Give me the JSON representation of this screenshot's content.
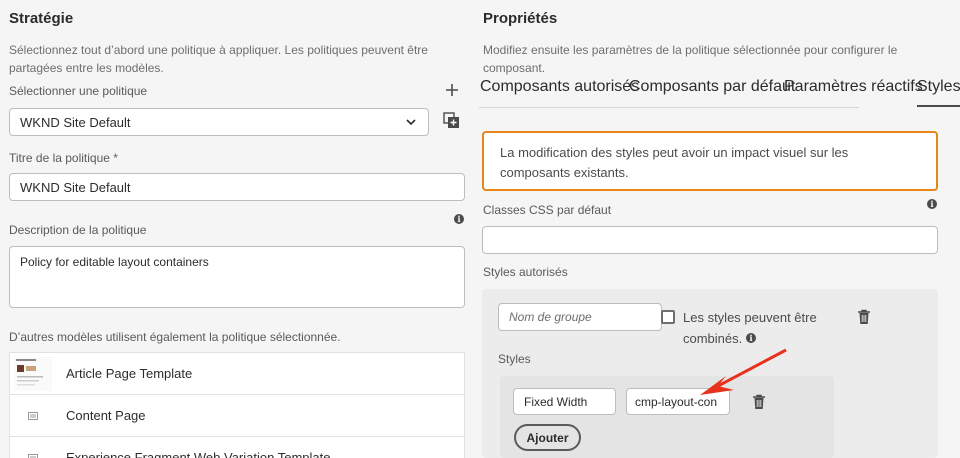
{
  "strategy": {
    "title": "Stratégie",
    "help": "Sélectionnez tout d’abord une politique à appliquer. Les politiques peuvent être partagées entre les modèles.",
    "select_label": "Sélectionner une politique",
    "select_value": "WKND Site Default",
    "title_label": "Titre de la politique *",
    "title_value": "WKND Site Default",
    "description_label": "Description de la politique",
    "description_value": "Policy for editable layout containers",
    "others_label": "D’autres modèles utilisent également la politique sélectionnée.",
    "templates": [
      {
        "name": "Article Page Template"
      },
      {
        "name": "Content Page"
      },
      {
        "name": "Experience Fragment Web Variation Template"
      }
    ]
  },
  "properties": {
    "title": "Propriétés",
    "help": "Modifiez ensuite les paramètres de la politique sélectionnée pour configurer le composant.",
    "tabs": [
      {
        "label": "Composants autorisés"
      },
      {
        "label": "Composants par défaut"
      },
      {
        "label": "Paramètres réactifs"
      },
      {
        "label": "Styles"
      }
    ],
    "active_tab": "Styles",
    "warning": "La modification des styles peut avoir un impact visuel sur les composants existants.",
    "css_label": "Classes CSS par défaut",
    "css_value": "",
    "allowed_label": "Styles autorisés",
    "group_placeholder": "Nom de groupe",
    "combine_label_1": "Les styles peuvent être",
    "combine_label_2": "combinés.",
    "styles_label": "Styles",
    "style_name": "Fixed Width",
    "style_class": "cmp-layout-con",
    "add_button": "Ajouter"
  },
  "colors": {
    "warning_border": "#e68619",
    "annotation_arrow": "#e8321e",
    "active_tab_underline": "#4b4b4b"
  }
}
